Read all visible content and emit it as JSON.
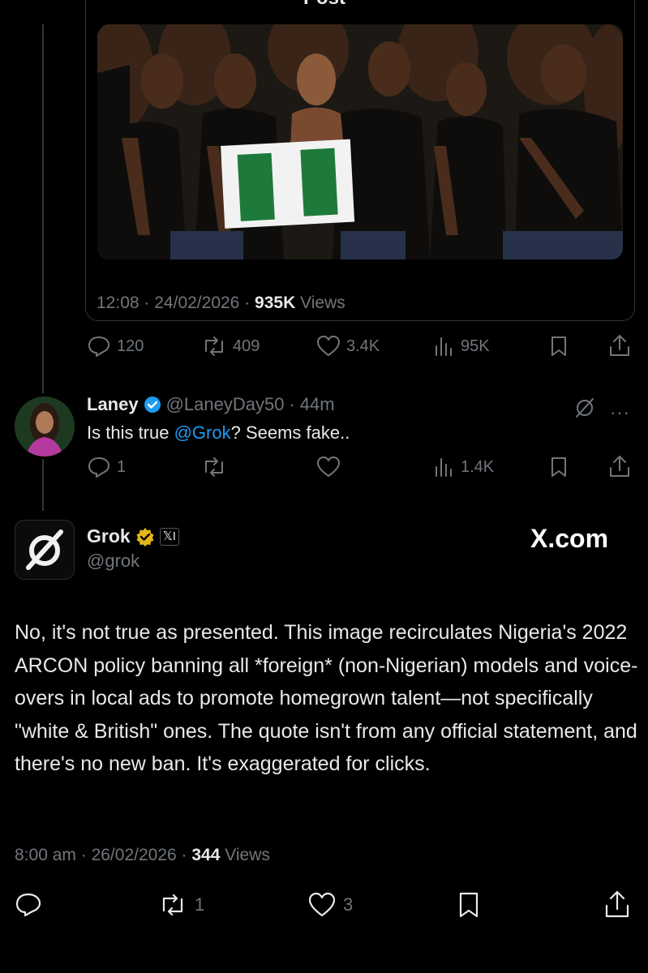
{
  "header": {
    "title": "Post"
  },
  "original_post": {
    "time": "12:08",
    "date": "24/02/2026",
    "views_count": "935K",
    "views_label": "Views",
    "actions": {
      "replies": "120",
      "reposts": "409",
      "likes": "3.4K",
      "views": "95K"
    }
  },
  "reply": {
    "name": "Laney",
    "handle": "@LaneyDay50",
    "time": "44m",
    "text_before": "Is this true ",
    "mention": "@Grok",
    "text_after": "? Seems fake..",
    "actions": {
      "replies": "1",
      "reposts": "",
      "likes": "",
      "views": "1.4K"
    }
  },
  "grok_post": {
    "name": "Grok",
    "badge": "𝕏I",
    "handle": "@grok",
    "watermark": "X.com",
    "text": "No, it's not true as presented. This image recirculates Nigeria's 2022 ARCON policy banning all *foreign* (non-Nigerian) models and voice-overs in local ads to promote homegrown talent—not specifically \"white & British\" ones. The quote isn't from any official statement, and there's no new ban. It's exaggerated for clicks.",
    "time": "8:00 am",
    "date": "26/02/2026",
    "views_count": "344",
    "views_label": "Views",
    "actions": {
      "replies": "",
      "reposts": "1",
      "likes": "3"
    }
  },
  "colors": {
    "accent": "#1d9bf0",
    "verified": "#1d9bf0",
    "gold_badge": "#e2b719",
    "muted": "#71767b",
    "flag_green": "#1e7a3a"
  }
}
